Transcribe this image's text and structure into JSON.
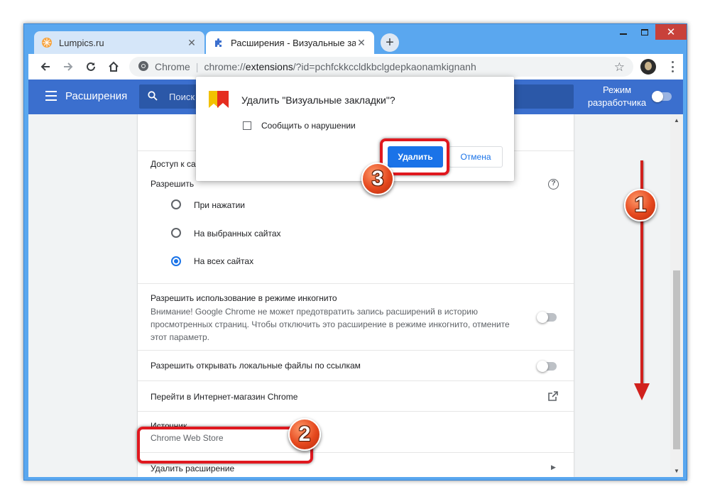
{
  "window": {
    "controls": {
      "minimize": "—",
      "maximize": "□",
      "close": "✕"
    }
  },
  "tabs": [
    {
      "title": "Lumpics.ru",
      "favicon": "orange-favicon",
      "active": false
    },
    {
      "title": "Расширения - Визуальные заклад",
      "favicon": "puzzle-icon",
      "active": true
    }
  ],
  "new_tab_label": "+",
  "omnibox": {
    "site_label": "Chrome",
    "separator": "|",
    "url_prefix": "chrome://",
    "url_host": "extensions",
    "url_rest": "/?id=pchfckkccldkbclgdepkaonamkignanh"
  },
  "extensions_header": {
    "title": "Расширения",
    "search_placeholder": "Поиск п",
    "dev_mode_label": "Режим разработчика",
    "dev_mode_on": false
  },
  "details": {
    "site_access_title": "Доступ к са",
    "allow_label": "Разрешить",
    "options": [
      {
        "label": "При нажатии",
        "selected": false
      },
      {
        "label": "На выбранных сайтах",
        "selected": false
      },
      {
        "label": "На всех сайтах",
        "selected": true
      }
    ],
    "incognito_title": "Разрешить использование в режиме инкогнито",
    "incognito_desc": [
      "Внимание! Google Chrome не может предотвратить запись расширений в историю",
      "просмотренных страниц. Чтобы отключить это расширение в режиме инкогнито, отмените",
      "этот параметр."
    ],
    "incognito_on": false,
    "local_files_label": "Разрешить открывать локальные файлы по ссылкам",
    "local_files_on": false,
    "webstore_label": "Перейти в Интернет-магазин Chrome",
    "source_title": "Источник",
    "source_value": "Chrome Web Store",
    "remove_label": "Удалить расширение"
  },
  "dialog": {
    "title": "Удалить \"Визуальные закладки\"?",
    "report_label": "Сообщить о нарушении",
    "report_checked": false,
    "delete_button": "Удалить",
    "cancel_button": "Отмена"
  },
  "annotations": {
    "step1": "1",
    "step2": "2",
    "step3": "3",
    "highlight_color": "#e0181f"
  },
  "colors": {
    "header_blue": "#3b6fce",
    "accent_blue": "#1a73e8",
    "frame_blue": "#5aa7ef"
  }
}
